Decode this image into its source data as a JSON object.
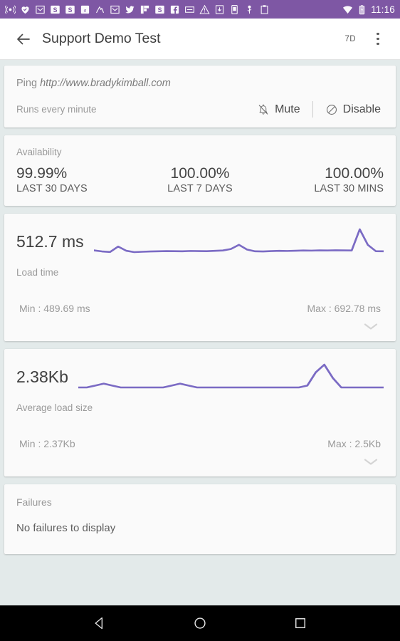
{
  "statusbar": {
    "time": "11:16",
    "left_icons": [
      "radio-icon",
      "heart-check-icon",
      "mail-icon",
      "s-app-icon",
      "s-app-icon-2",
      "amazon-icon",
      "music-icon",
      "mail-icon-2",
      "twitter-icon",
      "flipboard-icon",
      "s-app-icon-3",
      "facebook-icon",
      "screenshot-icon",
      "warning-icon",
      "download-icon",
      "device-icon",
      "usb-icon",
      "clipboard-icon"
    ],
    "right_icons": [
      "wifi-icon",
      "battery-charging-icon"
    ]
  },
  "appbar": {
    "back_icon": "arrow-left-icon",
    "title": "Support Demo Test",
    "range_label": "7D",
    "overflow_icon": "more-vertical-icon"
  },
  "ping_card": {
    "prefix": "Ping",
    "url": "http://www.bradykimball.com",
    "schedule": "Runs every minute",
    "mute_label": "Mute",
    "mute_icon": "bell-off-icon",
    "disable_label": "Disable",
    "disable_icon": "circle-slash-icon"
  },
  "availability": {
    "label": "Availability",
    "columns": [
      {
        "value": "99.99%",
        "period": "LAST 30 DAYS"
      },
      {
        "value": "100.00%",
        "period": "LAST 7 DAYS"
      },
      {
        "value": "100.00%",
        "period": "LAST 30 MINS"
      }
    ]
  },
  "load_time": {
    "value": "512.7 ms",
    "label": "Load time",
    "min": "Min : 489.69 ms",
    "max": "Max : 692.78 ms",
    "expand_icon": "chevron-down-icon"
  },
  "load_size": {
    "value": "2.38Kb",
    "label": "Average load size",
    "min": "Min : 2.37Kb",
    "max": "Max : 2.5Kb",
    "expand_icon": "chevron-down-icon"
  },
  "failures": {
    "label": "Failures",
    "empty_text": "No failures to display"
  },
  "navbar": {
    "back_icon": "nav-back-triangle-icon",
    "home_icon": "nav-home-circle-icon",
    "recents_icon": "nav-recents-square-icon"
  },
  "colors": {
    "status_bar": "#7e57a4",
    "spark_line": "#7b6bc4",
    "page_background": "#e3eaea",
    "card_background": "#fafafa"
  },
  "chart_data": [
    {
      "type": "line",
      "title": "Load time",
      "ylabel": "ms",
      "current": 512.7,
      "min": 489.69,
      "max": 692.78,
      "ylim": [
        489.69,
        692.78
      ],
      "grid": false,
      "legend": "none",
      "values": [
        512,
        503,
        498,
        545,
        509,
        497,
        500,
        503,
        504,
        506,
        505,
        504,
        507,
        506,
        505,
        508,
        511,
        524,
        560,
        519,
        504,
        503,
        506,
        508,
        507,
        509,
        511,
        510,
        512,
        511,
        513,
        512,
        511,
        693,
        560,
        505,
        504
      ]
    },
    {
      "type": "line",
      "title": "Average load size",
      "ylabel": "Kb",
      "current": 2.38,
      "min": 2.37,
      "max": 2.5,
      "ylim": [
        2.37,
        2.5
      ],
      "grid": false,
      "legend": "none",
      "values": [
        2.38,
        2.38,
        2.39,
        2.4,
        2.39,
        2.38,
        2.38,
        2.38,
        2.38,
        2.38,
        2.38,
        2.39,
        2.4,
        2.39,
        2.38,
        2.38,
        2.38,
        2.38,
        2.38,
        2.38,
        2.38,
        2.38,
        2.38,
        2.38,
        2.38,
        2.38,
        2.38,
        2.39,
        2.46,
        2.5,
        2.43,
        2.38,
        2.38,
        2.38,
        2.38,
        2.38,
        2.38
      ]
    }
  ]
}
